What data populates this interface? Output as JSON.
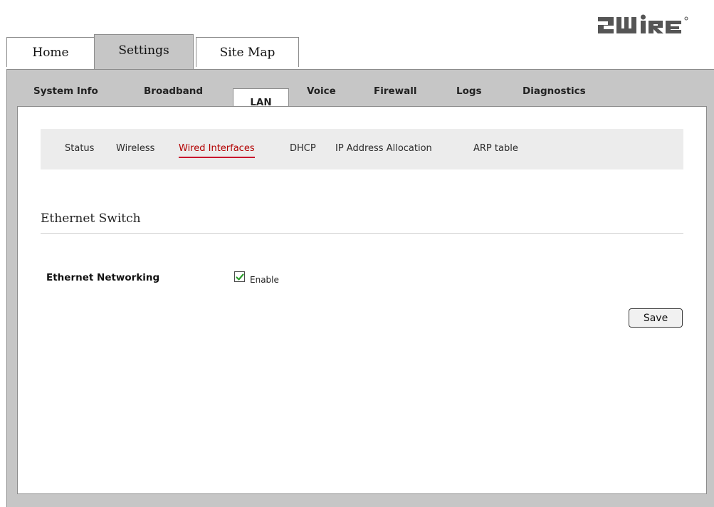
{
  "brand": {
    "logo_text": "2WIRE"
  },
  "top_tabs": [
    {
      "label": "Home",
      "active": false
    },
    {
      "label": "Settings",
      "active": true
    },
    {
      "label": "Site Map",
      "active": false
    }
  ],
  "sub_tabs": [
    {
      "label": "System Info",
      "active": false
    },
    {
      "label": "Broadband",
      "active": false
    },
    {
      "label": "LAN",
      "active": true
    },
    {
      "label": "Voice",
      "active": false
    },
    {
      "label": "Firewall",
      "active": false
    },
    {
      "label": "Logs",
      "active": false
    },
    {
      "label": "Diagnostics",
      "active": false
    }
  ],
  "lan_nav": [
    {
      "label": "Status",
      "active": false
    },
    {
      "label": "Wireless",
      "active": false
    },
    {
      "label": "Wired Interfaces",
      "active": true
    },
    {
      "label": "DHCP",
      "active": false
    },
    {
      "label": "IP Address Allocation",
      "active": false
    },
    {
      "label": "ARP table",
      "active": false
    }
  ],
  "content": {
    "section_title": "Ethernet Switch",
    "field_label": "Ethernet Networking",
    "enable_label": "Enable",
    "enable_checked": true,
    "save_label": "Save"
  },
  "colors": {
    "active_link": "#b30000",
    "underline": "#c8102e",
    "panel_gray": "#c6c6c6",
    "checkmark": "#2e9e2e"
  }
}
